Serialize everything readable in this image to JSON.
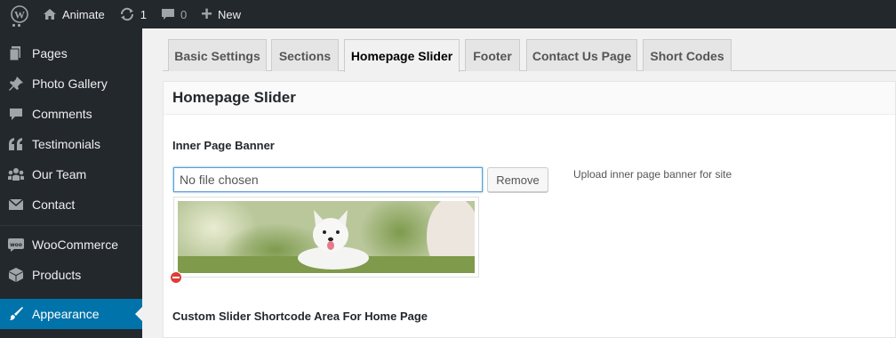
{
  "admin_bar": {
    "site_name": "Animate",
    "updates_count": "1",
    "comments_count": "0",
    "new_label": "New"
  },
  "sidebar": {
    "items": [
      {
        "label": "Pages",
        "icon": "pages-icon"
      },
      {
        "label": "Photo Gallery",
        "icon": "pin-icon"
      },
      {
        "label": "Comments",
        "icon": "comments-icon"
      },
      {
        "label": "Testimonials",
        "icon": "quote-icon"
      },
      {
        "label": "Our Team",
        "icon": "groups-icon"
      },
      {
        "label": "Contact",
        "icon": "email-icon"
      },
      {
        "label": "WooCommerce",
        "icon": "woocommerce-icon"
      },
      {
        "label": "Products",
        "icon": "archive-icon"
      },
      {
        "label": "Appearance",
        "icon": "paintbrush-icon"
      }
    ],
    "active": "Appearance"
  },
  "tabs": [
    {
      "label": "Basic Settings"
    },
    {
      "label": "Sections"
    },
    {
      "label": "Homepage Slider"
    },
    {
      "label": "Footer"
    },
    {
      "label": "Contact Us Page"
    },
    {
      "label": "Short Codes"
    }
  ],
  "active_tab": "Homepage Slider",
  "panel": {
    "title": "Homepage Slider",
    "banner_label": "Inner Page Banner",
    "file_input_value": "No file chosen",
    "remove_label": "Remove",
    "help_text": "Upload inner page banner for site",
    "shortcode_label": "Custom Slider Shortcode Area For Home Page"
  },
  "colors": {
    "admin_dark": "#23282d",
    "accent": "#0073aa",
    "focus": "#5b9dd9",
    "remove_red": "#dd3d36"
  }
}
